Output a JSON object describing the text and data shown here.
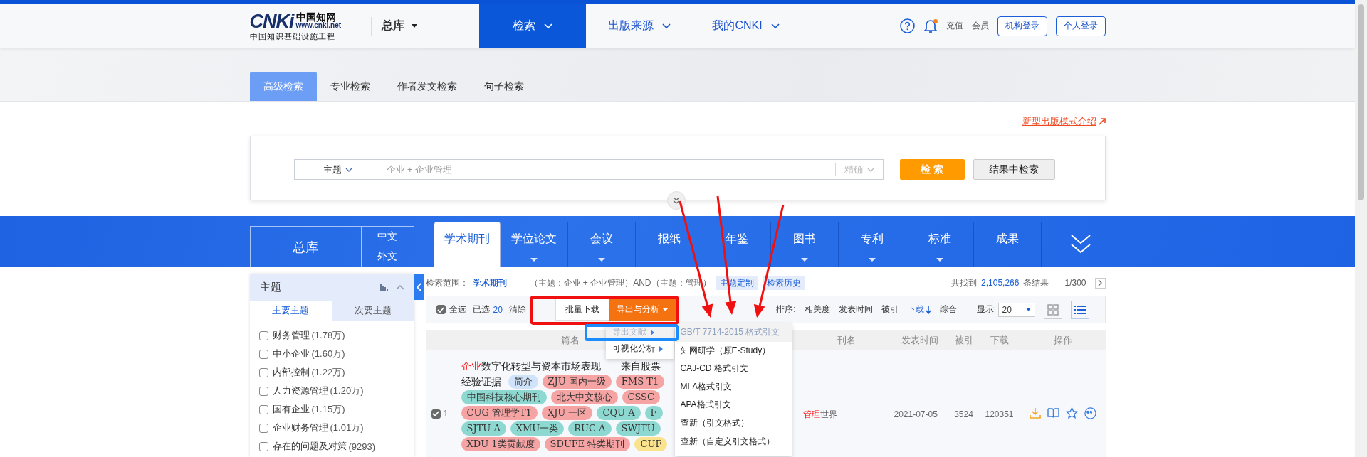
{
  "header": {
    "logo": {
      "mark": "CNKi",
      "name": "中国知网",
      "url": "www.cnki.net",
      "tagline": "中国知识基础设施工程"
    },
    "database": "总库",
    "has_notification": true,
    "nav": [
      {
        "label": "检索",
        "selected": true
      },
      {
        "label": "出版来源",
        "selected": false
      },
      {
        "label": "我的CNKI",
        "selected": false
      }
    ],
    "links": [
      "充值",
      "会员"
    ],
    "buttons": [
      "机构登录",
      "个人登录"
    ]
  },
  "search_tabs": [
    {
      "label": "高级检索",
      "selected": true
    },
    {
      "label": "专业检索",
      "selected": false
    },
    {
      "label": "作者发文检索",
      "selected": false
    },
    {
      "label": "句子检索",
      "selected": false
    }
  ],
  "promo_link": "新型出版模式介绍",
  "search": {
    "field": "主题",
    "placeholder": "企业 + 企业管理",
    "match": "精确",
    "search_button": "检 索",
    "refine_button": "结果中检索"
  },
  "source_bar": {
    "all": "总库",
    "languages": [
      "中文",
      "外文"
    ],
    "tabs": [
      {
        "label": "学术期刊",
        "selected": true,
        "has_menu": false
      },
      {
        "label": "学位论文",
        "selected": false,
        "has_menu": true
      },
      {
        "label": "会议",
        "selected": false,
        "has_menu": true
      },
      {
        "label": "报纸",
        "selected": false,
        "has_menu": false
      },
      {
        "label": "年鉴",
        "selected": false,
        "has_menu": false
      },
      {
        "label": "图书",
        "selected": false,
        "has_menu": true
      },
      {
        "label": "专利",
        "selected": false,
        "has_menu": true
      },
      {
        "label": "标准",
        "selected": false,
        "has_menu": true
      },
      {
        "label": "成果",
        "selected": false,
        "has_menu": false
      }
    ]
  },
  "sidebar": {
    "title": "主题",
    "tabs": [
      {
        "label": "主要主题",
        "selected": true
      },
      {
        "label": "次要主题",
        "selected": false
      }
    ],
    "items": [
      {
        "label": "财务管理",
        "count": "(1.78万)",
        "checked": false
      },
      {
        "label": "中小企业",
        "count": "(1.60万)",
        "checked": false
      },
      {
        "label": "内部控制",
        "count": "(1.22万)",
        "checked": false
      },
      {
        "label": "人力资源管理",
        "count": "(1.20万)",
        "checked": false
      },
      {
        "label": "国有企业",
        "count": "(1.15万)",
        "checked": false
      },
      {
        "label": "企业财务管理",
        "count": "(1.01万)",
        "checked": false
      },
      {
        "label": "存在的问题及对策",
        "count": "(9293)",
        "checked": false
      }
    ]
  },
  "scope": {
    "label": "检索范围：",
    "value": "学术期刊",
    "query": "（主题：企业 + 企业管理）AND（主题：管理）",
    "buttons": [
      "主题定制",
      "检索历史"
    ],
    "found_prefix": "共找到",
    "total": "2,105,266",
    "found_suffix": "条结果",
    "page": "1/300"
  },
  "toolbar": {
    "select_all": {
      "label": "全选",
      "checked": true
    },
    "selected_label": "已选",
    "selected_count": "20",
    "clear": "清除",
    "batch_download": "批量下载",
    "export": "导出与分析",
    "sort_label": "排序:",
    "sort": [
      {
        "label": "相关度",
        "selected": false
      },
      {
        "label": "发表时间",
        "selected": false
      },
      {
        "label": "被引",
        "selected": false
      },
      {
        "label": "下载",
        "selected": true
      },
      {
        "label": "综合",
        "selected": false
      }
    ],
    "page_size_label": "显示",
    "page_size": "20",
    "views": [
      {
        "kind": "grid",
        "selected": false
      },
      {
        "kind": "list",
        "selected": true
      }
    ]
  },
  "columns": [
    "篇名",
    "刊名",
    "发表时间",
    "被引",
    "下载",
    "操作"
  ],
  "rows": [
    {
      "checked": true,
      "index": "1",
      "title": [
        {
          "text": "企业",
          "highlight": true
        },
        {
          "text": "数字化转型与资本市场表现——来自股票",
          "highlight": false
        }
      ],
      "title_end": "经验证据",
      "tags": [
        {
          "label": "简介",
          "color": "#cfe3fa"
        },
        {
          "label": "ZJU 国内一级",
          "color": "#f6a3a3"
        },
        {
          "label": "FMS T1",
          "color": "#f6a3a3"
        },
        {
          "label": "中国科技核心期刊",
          "color": "#8dd9d1"
        },
        {
          "label": "北大中文核心",
          "color": "#f6a3a3"
        },
        {
          "label": "CSSC",
          "color": "#f6a3a3"
        },
        {
          "label": "CUG 管理学T1",
          "color": "#f6a3a3"
        },
        {
          "label": "XJU 一区",
          "color": "#f6a3a3"
        },
        {
          "label": "CQU A",
          "color": "#8dd9d1"
        },
        {
          "label": "F",
          "color": "#8dd9d1"
        },
        {
          "label": "SJTU A",
          "color": "#8dd9d1"
        },
        {
          "label": "XMU一类",
          "color": "#8dd9d1"
        },
        {
          "label": "RUC A",
          "color": "#8dd9d1"
        },
        {
          "label": "SWJTU",
          "color": "#8dd9d1"
        },
        {
          "label": "XDU 1类贡献度",
          "color": "#f6a3a3"
        },
        {
          "label": "SDUFE 特类期刊",
          "color": "#f6a3a3"
        },
        {
          "label": "CUF",
          "color": "#fbe28d"
        }
      ],
      "journal": [
        {
          "text": "管理",
          "highlight": true
        },
        {
          "text": "世界",
          "highlight": false
        }
      ],
      "date": "2021-07-05",
      "cited": "3524",
      "downloads": "120351"
    }
  ],
  "export_menu": {
    "items": [
      {
        "label": "导出文献",
        "selected": true
      },
      {
        "label": "可视化分析",
        "selected": false
      }
    ],
    "submenu": [
      {
        "label": "GB/T 7714-2015 格式引文",
        "selected": true
      },
      {
        "label": "知网研学（原E-Study）",
        "selected": false
      },
      {
        "label": "CAJ-CD 格式引文",
        "selected": false
      },
      {
        "label": "MLA格式引文",
        "selected": false
      },
      {
        "label": "APA格式引文",
        "selected": false
      },
      {
        "label": "查新（引文格式）",
        "selected": false
      },
      {
        "label": "查新（自定义引文格式）",
        "selected": false
      }
    ]
  }
}
